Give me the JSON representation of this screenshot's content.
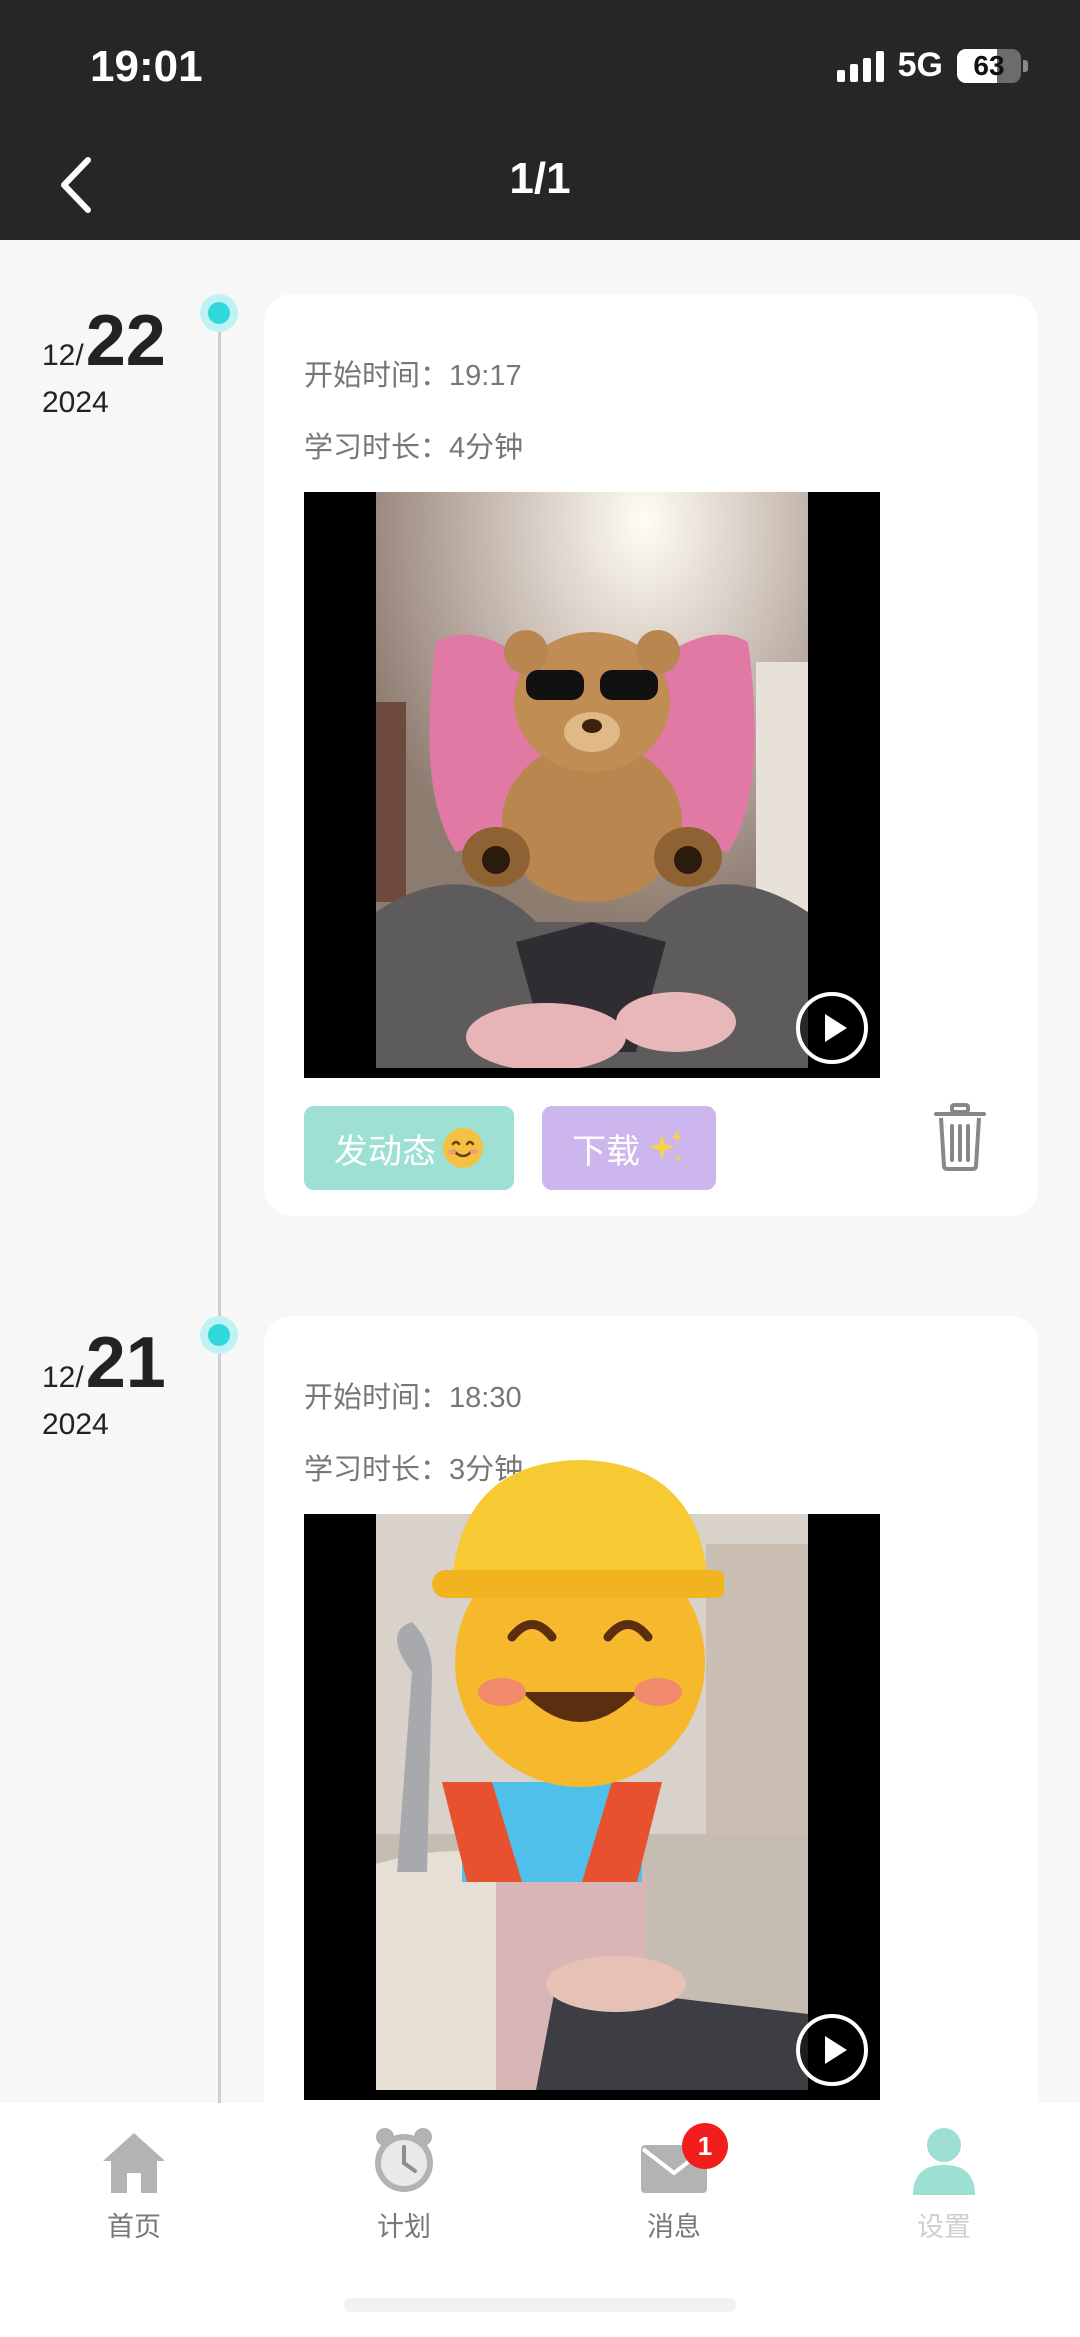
{
  "status_bar": {
    "time": "19:01",
    "network": "5G",
    "battery": "63",
    "battery_level": 0.63
  },
  "nav": {
    "title": "1/1"
  },
  "entries": [
    {
      "month": "12/",
      "day": "22",
      "year": "2024",
      "start_time": "开始时间：19:17",
      "duration": "学习时长：4分钟",
      "post_label": "发动态",
      "download_label": "下载"
    },
    {
      "month": "12/",
      "day": "21",
      "year": "2024",
      "start_time": "开始时间：18:30",
      "duration": "学习时长：3分钟"
    }
  ],
  "tabs": [
    {
      "label": "首页",
      "icon": "home-icon"
    },
    {
      "label": "计划",
      "icon": "alarm-clock-icon"
    },
    {
      "label": "消息",
      "icon": "mail-icon",
      "badge": "1"
    },
    {
      "label": "设置",
      "icon": "person-icon"
    }
  ],
  "colors": {
    "header": "#262626",
    "timeline_dot": "#2fd8db",
    "post_button": "#9ee0d4",
    "download_button": "#cdb6ee",
    "badge": "#f21e1e",
    "settings_tab": "#9de0d3"
  }
}
